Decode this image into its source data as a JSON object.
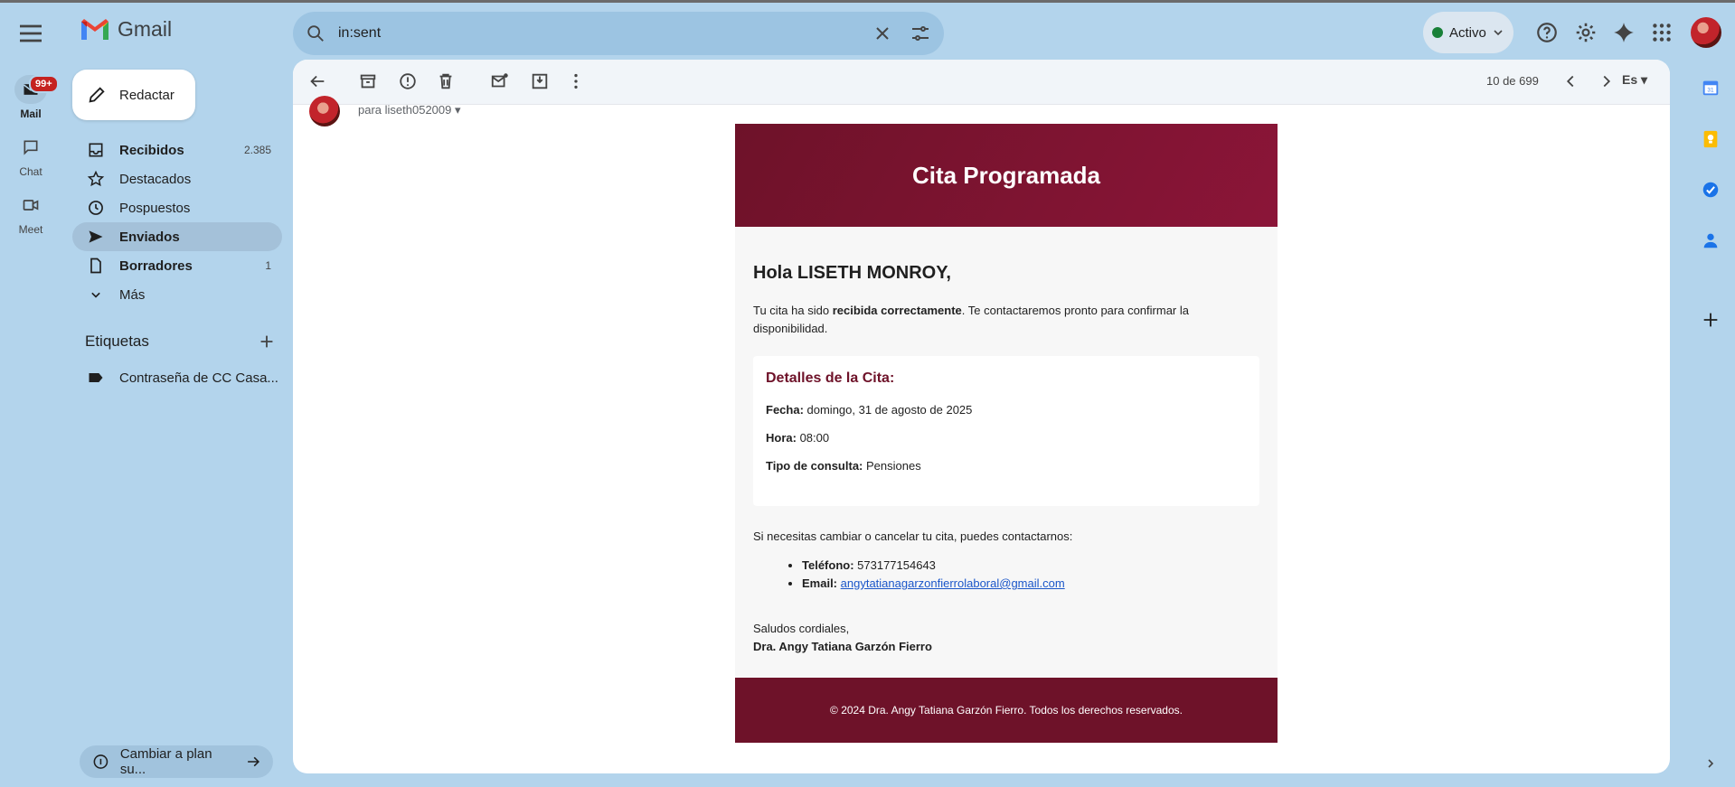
{
  "app": {
    "name": "Gmail"
  },
  "search": {
    "value": "in:sent"
  },
  "status": {
    "label": "Activo"
  },
  "rail": {
    "badge": "99+",
    "items": [
      {
        "label": "Mail"
      },
      {
        "label": "Chat"
      },
      {
        "label": "Meet"
      }
    ]
  },
  "compose": {
    "label": "Redactar"
  },
  "nav": [
    {
      "label": "Recibidos",
      "count": "2.385"
    },
    {
      "label": "Destacados",
      "count": ""
    },
    {
      "label": "Pospuestos",
      "count": ""
    },
    {
      "label": "Enviados",
      "count": ""
    },
    {
      "label": "Borradores",
      "count": "1"
    },
    {
      "label": "Más",
      "count": ""
    }
  ],
  "labels": {
    "title": "Etiquetas",
    "items": [
      {
        "label": "Contraseña de CC Casa..."
      }
    ]
  },
  "upgrade": {
    "label": "Cambiar a plan su..."
  },
  "toolbar": {
    "pager": "10 de 699",
    "lang": "Es"
  },
  "message": {
    "recipient": "para liseth052009",
    "header_title": "Cita Programada",
    "greeting": "Hola LISETH MONROY,",
    "intro_before": "Tu cita ha sido ",
    "intro_bold": "recibida correctamente",
    "intro_after": ". Te contactaremos pronto para confirmar la disponibilidad.",
    "details_title": "Detalles de la Cita:",
    "details": [
      {
        "label": "Fecha:",
        "value": " domingo, 31 de agosto de 2025"
      },
      {
        "label": "Hora:",
        "value": " 08:00"
      },
      {
        "label": "Tipo de consulta:",
        "value": " Pensiones"
      }
    ],
    "contact_intro": "Si necesitas cambiar o cancelar tu cita, puedes contactarnos:",
    "phone_label": "Teléfono:",
    "phone_value": " 573177154643",
    "email_label": "Email:",
    "email_value": "angytatianagarzonfierrolaboral@gmail.com",
    "closing": "Saludos cordiales,",
    "signature": "Dra. Angy Tatiana Garzón Fierro",
    "footer": "© 2024 Dra. Angy Tatiana Garzón Fierro. Todos los derechos reservados."
  },
  "colors": {
    "brand_header": "#8b1538",
    "brand_footer": "#6e1229",
    "background": "#b3d4ec",
    "active_nav": "#a4c1d9",
    "status_green": "#188038",
    "badge_red": "#c5221f"
  }
}
